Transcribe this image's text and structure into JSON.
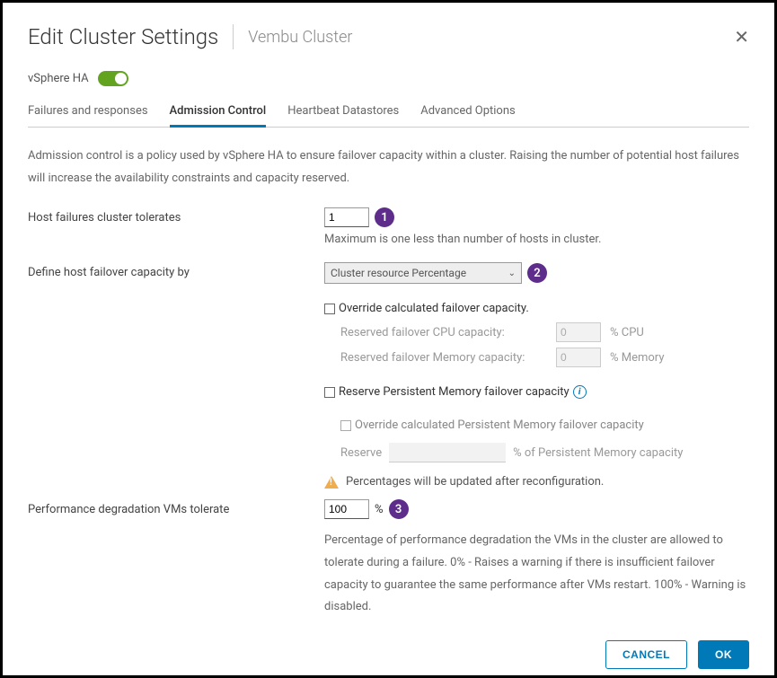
{
  "dialog": {
    "title": "Edit Cluster Settings",
    "cluster_name": "Vembu Cluster"
  },
  "ha": {
    "label": "vSphere HA",
    "enabled": true
  },
  "tabs": [
    {
      "label": "Failures and responses",
      "active": false
    },
    {
      "label": "Admission Control",
      "active": true
    },
    {
      "label": "Heartbeat Datastores",
      "active": false
    },
    {
      "label": "Advanced Options",
      "active": false
    }
  ],
  "description": "Admission control is a policy used by vSphere HA to ensure failover capacity within a cluster. Raising the number of potential host failures will increase the availability constraints and capacity reserved.",
  "host_failures": {
    "label": "Host failures cluster tolerates",
    "value": "1",
    "hint": "Maximum is one less than number of hosts in cluster."
  },
  "failover_capacity": {
    "label": "Define host failover capacity by",
    "selected": "Cluster resource Percentage",
    "override_label": "Override calculated failover capacity.",
    "cpu": {
      "label": "Reserved failover CPU capacity:",
      "value": "0",
      "suffix": "% CPU"
    },
    "memory": {
      "label": "Reserved failover Memory capacity:",
      "value": "0",
      "suffix": "% Memory"
    },
    "pmem_label": "Reserve Persistent Memory failover capacity",
    "pmem_override_label": "Override calculated Persistent Memory failover capacity",
    "reserve": {
      "label": "Reserve",
      "suffix": "% of Persistent Memory capacity"
    },
    "warning": "Percentages will be updated after reconfiguration."
  },
  "performance": {
    "label": "Performance degradation VMs tolerate",
    "value": "100",
    "unit": "%",
    "description": "Percentage of performance degradation the VMs in the cluster are allowed to tolerate during a failure. 0% - Raises a warning if there is insufficient failover capacity to guarantee the same performance after VMs restart. 100% - Warning is disabled."
  },
  "buttons": {
    "cancel": "CANCEL",
    "ok": "OK"
  },
  "badges": {
    "b1": "1",
    "b2": "2",
    "b3": "3"
  }
}
